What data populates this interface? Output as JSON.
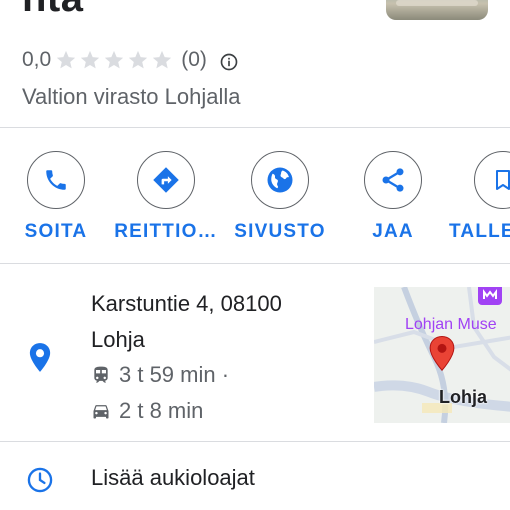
{
  "place": {
    "title_fragment": "nta",
    "rating": "0,0",
    "stars_filled": 0,
    "stars_total": 5,
    "review_count": "(0)",
    "category": "Valtion virasto Lohjalla"
  },
  "actions": [
    {
      "label": "SOITA",
      "icon": "phone-icon"
    },
    {
      "label": "REITTIO…",
      "icon": "directions-icon"
    },
    {
      "label": "SIVUSTO",
      "icon": "globe-icon"
    },
    {
      "label": "JAA",
      "icon": "share-icon"
    },
    {
      "label": "TALLE",
      "icon": "bookmark-icon"
    }
  ],
  "address": {
    "line1": "Karstuntie 4, 08100",
    "line2": "Lohja",
    "transit_time": "3 t 59 min ·",
    "drive_time": "2 t 8 min"
  },
  "map": {
    "museum_label": "Lohjan Muse",
    "city_label": "Lohja"
  },
  "hours": {
    "label": "Lisää aukioloajat"
  },
  "colors": {
    "accent": "#1a73e8",
    "text_primary": "#202124",
    "text_secondary": "#5f6368",
    "pin_red": "#ea4335",
    "museum_purple": "#a142f4"
  }
}
